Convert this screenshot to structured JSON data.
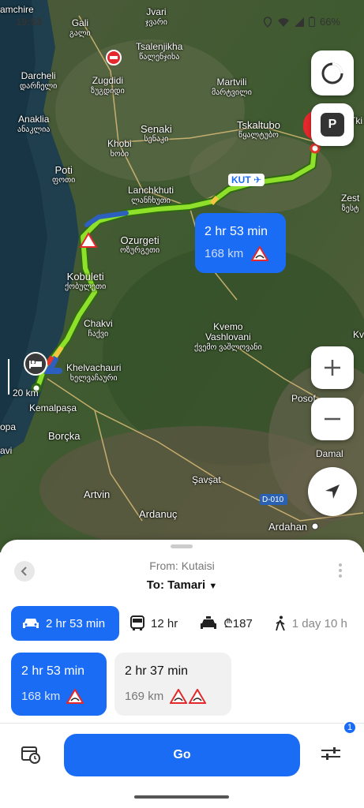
{
  "status": {
    "time": "19:53",
    "battery": "66%"
  },
  "places": {
    "gali": {
      "name": "Gali",
      "sub": "გალი"
    },
    "jvari": {
      "name": "Jvari",
      "sub": "ჯვარი"
    },
    "tsalenjikha": {
      "name": "Tsalenjikha",
      "sub": "წალენჯიხა"
    },
    "darcheli": {
      "name": "Darcheli",
      "sub": "დარჩელი"
    },
    "zugdidi": {
      "name": "Zugdidi",
      "sub": "ზუგდიდი"
    },
    "martvili": {
      "name": "Martvili",
      "sub": "მარტვილი"
    },
    "anaklia": {
      "name": "Anaklia",
      "sub": "ანაკლია"
    },
    "senaki": {
      "name": "Senaki",
      "sub": "სენაკი"
    },
    "tskaltubo": {
      "name": "Tskaltubo",
      "sub": "წყალტუბო"
    },
    "khobi": {
      "name": "Khobi",
      "sub": "ხობი"
    },
    "poti": {
      "name": "Poti",
      "sub": "ფოთი"
    },
    "lanchkhuti": {
      "name": "Lanchkhuti",
      "sub": "ლანჩხუთი"
    },
    "zest": {
      "name": "Zest",
      "sub": "ზესტ"
    },
    "ozurgeti": {
      "name": "Ozurgeti",
      "sub": "ოზურგეთი"
    },
    "kobuleti": {
      "name": "Kobuleti",
      "sub": "ქობულეთი"
    },
    "chakvi": {
      "name": "Chakvi",
      "sub": "ჩაქვი"
    },
    "kvemo": {
      "name": "Kvemo",
      "sub": "Vashlovani",
      "sub2": "ქვემო ვაშლოვანი"
    },
    "khelvachauri": {
      "name": "Khelvachauri",
      "sub": "ხელვაჩაური"
    },
    "kemalpasa": {
      "name": "Kemalpaşa"
    },
    "posof": {
      "name": "Posof"
    },
    "borcka": {
      "name": "Borçka"
    },
    "damal": {
      "name": "Damal"
    },
    "savsat": {
      "name": "Şavşat"
    },
    "artvin": {
      "name": "Artvin"
    },
    "ardanuc": {
      "name": "Ardanuç"
    },
    "ardahan": {
      "name": "Ardahan"
    },
    "amchire": {
      "name": "amchire"
    },
    "opa": {
      "name": "opa"
    },
    "avi": {
      "name": "avi"
    },
    "tki": {
      "name": "Tki"
    },
    "kva": {
      "name": "Kva"
    }
  },
  "map": {
    "airport": "KUT",
    "road": "D-010",
    "scale": "20 km",
    "route_card": {
      "time": "2 hr 53 min",
      "distance": "168 km"
    },
    "parking_label": "P"
  },
  "sheet": {
    "from": "From: Kutaisi",
    "to": "To: Tamari",
    "modes": [
      {
        "icon": "car-icon",
        "label": "2 hr 53 min",
        "active": true
      },
      {
        "icon": "bus-icon",
        "label": "12 hr"
      },
      {
        "icon": "taxi-icon",
        "label": "₾187"
      },
      {
        "icon": "walk-icon",
        "label": "1 day 10 h"
      }
    ],
    "routes": [
      {
        "time": "2 hr 53 min",
        "distance": "168 km"
      },
      {
        "time": "2 hr 37 min",
        "distance": "169 km"
      }
    ],
    "go": "Go",
    "filter_badge": "1"
  },
  "colors": {
    "accent": "#1a6cf5",
    "route": "#8ee02b",
    "traffic": "#f4c542"
  }
}
